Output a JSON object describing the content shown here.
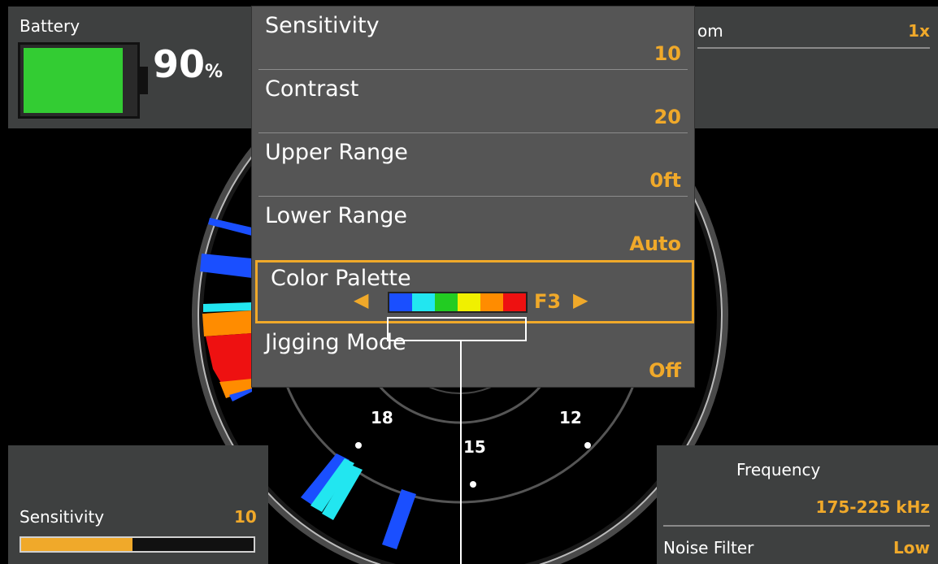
{
  "battery": {
    "label": "Battery",
    "percent_value": "90",
    "percent_unit": "%",
    "level": 0.9,
    "fill_color": "#33cc33"
  },
  "zoom": {
    "label": "om",
    "value": "1x"
  },
  "sensitivity_panel": {
    "label": "Sensitivity",
    "value": "10",
    "level": 0.48
  },
  "frequency_panel": {
    "label": "Frequency",
    "value": "175-225 kHz",
    "noise_label": "Noise Filter",
    "noise_value": "Low"
  },
  "menu": {
    "items": [
      {
        "label": "Sensitivity",
        "value": "10"
      },
      {
        "label": "Contrast",
        "value": "20"
      },
      {
        "label": "Upper Range",
        "value": "0ft"
      },
      {
        "label": "Lower Range",
        "value": "Auto"
      },
      {
        "label": "Color Palette",
        "value": "F3",
        "selected": true,
        "left_arrow": "◀",
        "right_arrow": "▶"
      },
      {
        "label": "Jigging Mode",
        "value": "Off"
      }
    ],
    "palette_colors": [
      "#1a4fff",
      "#22e6f0",
      "#22cc22",
      "#f0f000",
      "#ff8c00",
      "#ee1111"
    ]
  },
  "dial": {
    "labels": [
      "18",
      "15",
      "12"
    ]
  },
  "colors": {
    "accent": "#f0a92a",
    "panel": "#3e4040",
    "menu": "#555555"
  }
}
